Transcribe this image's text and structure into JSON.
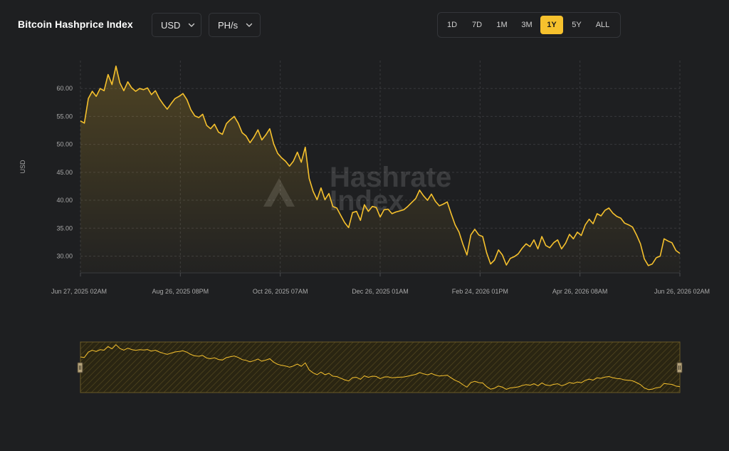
{
  "header": {
    "title": "Bitcoin Hashprice Index",
    "currency_dropdown": "USD",
    "unit_dropdown": "PH/s",
    "chevron_icon": "chevron-down-icon"
  },
  "range_buttons": [
    {
      "label": "1D",
      "active": false
    },
    {
      "label": "7D",
      "active": false
    },
    {
      "label": "1M",
      "active": false
    },
    {
      "label": "3M",
      "active": false
    },
    {
      "label": "1Y",
      "active": true
    },
    {
      "label": "5Y",
      "active": false
    },
    {
      "label": "ALL",
      "active": false
    }
  ],
  "watermark": {
    "line1": "Hashrate",
    "line2": "Index",
    "icon": "hashrate-index-logo-icon"
  },
  "colors": {
    "accent": "#f6c12d",
    "background": "#1e1f21",
    "grid": "#3a3b3e",
    "text": "#a9a9a9"
  },
  "chart_data": {
    "type": "area",
    "title": "Bitcoin Hashprice Index",
    "ylabel": "USD",
    "xlabel": "",
    "ylim": [
      27,
      65
    ],
    "y_ticks": [
      "30.00",
      "35.00",
      "40.00",
      "45.00",
      "50.00",
      "55.00",
      "60.00"
    ],
    "x_tick_labels": [
      "Jun 27, 2025 02AM",
      "Aug 26, 2025 08PM",
      "Oct 26, 2025 07AM",
      "Dec 26, 2025 01AM",
      "Feb 24, 2026 01PM",
      "Apr 26, 2026 08AM",
      "Jun 26, 2026 02AM"
    ],
    "grid": true,
    "legend": "none",
    "series": [
      {
        "values": [
          54.2,
          53.8,
          58.2,
          59.5,
          58.6,
          60.0,
          59.6,
          62.5,
          60.7,
          64.0,
          61.0,
          59.6,
          61.2,
          60.1,
          59.5,
          60.0,
          59.8,
          60.1,
          58.9,
          59.6,
          58.2,
          57.2,
          56.3,
          57.3,
          58.2,
          58.6,
          59.1,
          58.0,
          56.2,
          55.1,
          54.8,
          55.4,
          53.4,
          52.8,
          53.6,
          52.2,
          51.8,
          53.7,
          54.4,
          55.0,
          53.8,
          52.1,
          51.5,
          50.3,
          51.3,
          52.6,
          50.8,
          51.7,
          52.8,
          50.1,
          48.4,
          47.6,
          47.0,
          46.1,
          47.0,
          48.6,
          46.8,
          49.5,
          43.9,
          41.6,
          40.1,
          42.2,
          40.1,
          41.2,
          38.9,
          38.6,
          37.3,
          36.0,
          35.1,
          37.8,
          38.0,
          36.4,
          39.2,
          38.0,
          38.9,
          38.7,
          37.0,
          38.3,
          38.4,
          37.6,
          37.9,
          38.1,
          38.3,
          38.9,
          39.6,
          40.3,
          41.8,
          40.8,
          40.0,
          41.1,
          39.8,
          39.0,
          39.3,
          39.7,
          37.6,
          35.6,
          34.3,
          32.1,
          30.2,
          33.8,
          34.8,
          33.8,
          33.5,
          30.6,
          28.6,
          29.3,
          31.1,
          30.2,
          28.4,
          29.6,
          29.9,
          30.4,
          31.4,
          32.2,
          31.7,
          32.9,
          31.3,
          33.5,
          31.9,
          31.5,
          32.4,
          32.9,
          31.3,
          32.3,
          33.9,
          33.1,
          34.3,
          33.7,
          35.6,
          36.6,
          35.8,
          37.6,
          37.2,
          38.2,
          38.6,
          37.7,
          37.1,
          36.8,
          35.9,
          35.6,
          35.2,
          33.8,
          32.2,
          29.5,
          28.3,
          28.6,
          29.7,
          30.0,
          33.1,
          32.7,
          32.4,
          31.0,
          30.5
        ]
      }
    ]
  }
}
